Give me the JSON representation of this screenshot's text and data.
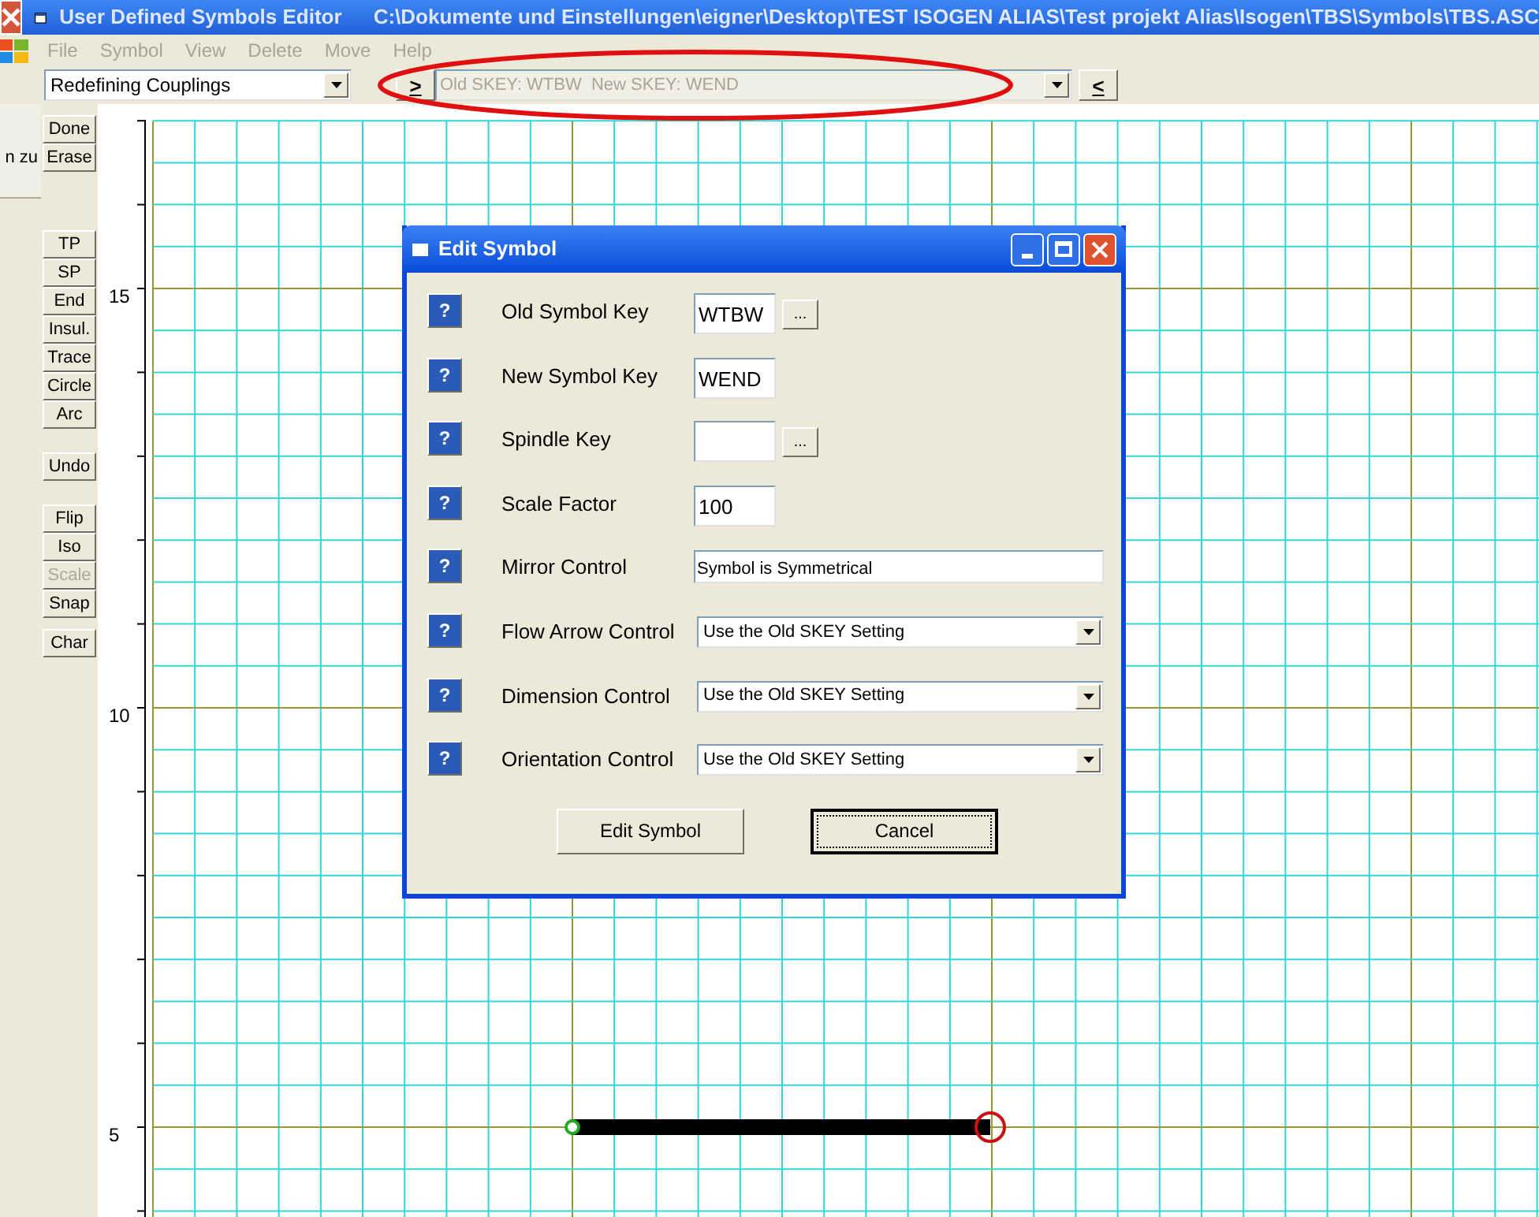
{
  "window": {
    "title": "User Defined Symbols Editor",
    "path": "C:\\Dokumente und Einstellungen\\eigner\\Desktop\\TEST ISOGEN ALIAS\\Test projekt Alias\\Isogen\\TBS\\Symbols\\TBS.ASC"
  },
  "menu": [
    {
      "label": "File",
      "disabled": true
    },
    {
      "label": "Symbol",
      "disabled": true
    },
    {
      "label": "View",
      "disabled": true
    },
    {
      "label": "Delete",
      "disabled": true
    },
    {
      "label": "Move",
      "disabled": true
    },
    {
      "label": "Help",
      "disabled": true
    }
  ],
  "toolbar": {
    "mode_select": "Redefining Couplings",
    "next_button": ">",
    "skey_field": {
      "value": "Old SKEY: WTBW  New SKEY: WEND",
      "disabled": true
    },
    "prev_button": "<"
  },
  "side_panel": {
    "text": "n zu"
  },
  "tool_groups": [
    {
      "buttons": [
        {
          "label": "Done",
          "disabled": false
        },
        {
          "label": "Erase",
          "disabled": false
        }
      ]
    },
    {
      "buttons": [
        {
          "label": "TP",
          "disabled": false
        },
        {
          "label": "SP",
          "disabled": false
        },
        {
          "label": "End",
          "disabled": false
        },
        {
          "label": "Insul.",
          "disabled": false
        },
        {
          "label": "Trace",
          "disabled": false
        },
        {
          "label": "Circle",
          "disabled": false
        },
        {
          "label": "Arc",
          "disabled": false
        }
      ]
    },
    {
      "buttons": [
        {
          "label": "Undo",
          "disabled": false
        }
      ]
    },
    {
      "buttons": [
        {
          "label": "Flip",
          "disabled": false
        },
        {
          "label": "Iso",
          "disabled": false
        },
        {
          "label": "Scale",
          "disabled": true
        },
        {
          "label": "Snap",
          "disabled": false
        }
      ]
    },
    {
      "buttons": [
        {
          "label": "Char",
          "disabled": false
        }
      ]
    }
  ],
  "ruler_labels": [
    "15",
    "10",
    "5"
  ],
  "dialog": {
    "title": "Edit Symbol",
    "help_button": "?",
    "fields": [
      {
        "label": "Old Symbol Key",
        "kind": "text",
        "value": "WTBW",
        "browse": "..."
      },
      {
        "label": "New Symbol Key",
        "kind": "text",
        "value": "WEND"
      },
      {
        "label": "Spindle Key",
        "kind": "text",
        "browse": "..."
      },
      {
        "label": "Scale Factor",
        "kind": "text",
        "value": "100"
      },
      {
        "label": "Mirror Control",
        "kind": "wide",
        "value": "Symbol is Symmetrical"
      },
      {
        "label": "Flow Arrow Control",
        "kind": "select",
        "value": "Use the Old SKEY Setting"
      },
      {
        "label": "Dimension Control",
        "kind": "select",
        "value": "Use the Old SKEY Setting"
      },
      {
        "label": "Orientation Control",
        "kind": "select",
        "value": "Use the Old SKEY Setting"
      }
    ],
    "buttons": [
      {
        "label": "Edit Symbol",
        "focused": false
      },
      {
        "label": "Cancel",
        "focused": true
      }
    ]
  }
}
